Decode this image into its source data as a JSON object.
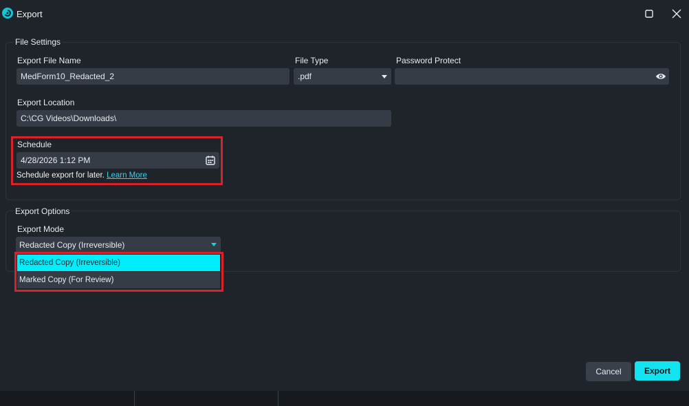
{
  "window": {
    "title": "Export"
  },
  "file_settings": {
    "legend": "File Settings",
    "export_file_name": {
      "label": "Export File Name",
      "value": "MedForm10_Redacted_2"
    },
    "file_type": {
      "label": "File Type",
      "value": ".pdf"
    },
    "password_protect": {
      "label": "Password Protect",
      "value": ""
    },
    "export_location": {
      "label": "Export Location",
      "value": "C:\\CG Videos\\Downloads\\"
    },
    "schedule": {
      "label": "Schedule",
      "value": "4/28/2026 1:12 PM",
      "helper_text": "Schedule export for later.",
      "learn_more": "Learn More"
    }
  },
  "export_options": {
    "legend": "Export Options",
    "export_mode": {
      "label": "Export Mode",
      "selected": "Redacted Copy (Irreversible)",
      "options": [
        "Redacted Copy (Irreversible)",
        "Marked Copy (For Review)"
      ]
    }
  },
  "buttons": {
    "cancel": "Cancel",
    "export": "Export"
  },
  "colors": {
    "accent": "#12e3f1",
    "highlight": "#d8232a",
    "background": "#1f232a",
    "field": "#363c45"
  },
  "icons": [
    "app-logo-icon",
    "maximize-icon",
    "close-icon",
    "chevron-down-icon",
    "eye-icon",
    "calendar-icon"
  ]
}
